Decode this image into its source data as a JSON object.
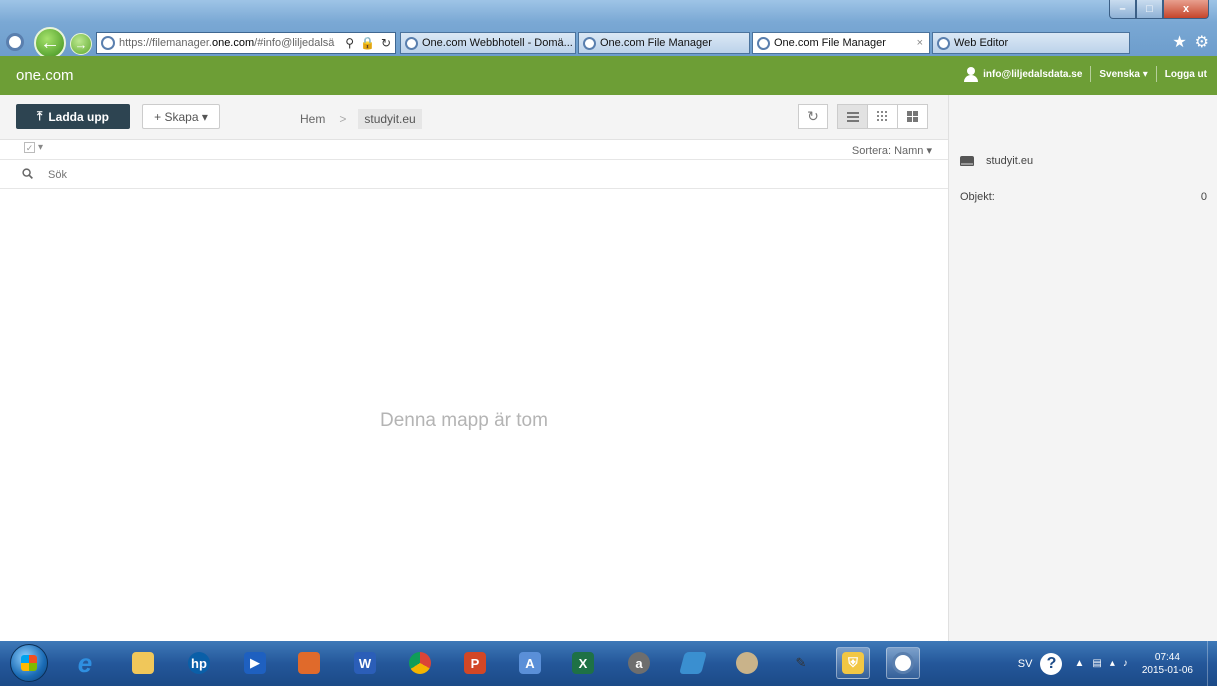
{
  "browser": {
    "address_url_prefix": "https://filemanager.",
    "address_url_domain": "one.com",
    "address_url_suffix": "/#info@liljedalsä",
    "tabs": [
      {
        "label": "One.com Webbhotell - Domä...",
        "active": false
      },
      {
        "label": "One.com File Manager",
        "active": false
      },
      {
        "label": "One.com File Manager",
        "active": true
      },
      {
        "label": "Web Editor",
        "active": false
      }
    ],
    "close_tab_glyph": "×"
  },
  "app": {
    "brand": "one.com",
    "user_email": "info@liljedalsdata.se",
    "language": "Svenska ▾",
    "logout": "Logga ut"
  },
  "toolbar": {
    "upload_label": "Ladda upp",
    "upload_icon": "⤒",
    "create_label": "+ Skapa ▾",
    "breadcrumb_home": "Hem",
    "breadcrumb_separator": ">",
    "breadcrumb_current": "studyit.eu",
    "refresh_icon": "↻"
  },
  "list": {
    "select_glyph": "✓",
    "select_caret": "▾",
    "sort_label": "Sortera: Namn ▾",
    "search_placeholder": "Sök",
    "empty_message": "Denna mapp är tom"
  },
  "panel": {
    "folder_name": "studyit.eu",
    "objects_label": "Objekt:",
    "objects_count": "0"
  },
  "taskbar": {
    "apps": [
      "internet-explorer",
      "file-explorer",
      "hp-app",
      "media-player",
      "paint-app",
      "word",
      "chrome",
      "powerpoint-app",
      "text-editor",
      "excel",
      "adobe-app",
      "pen-app",
      "palette-app",
      "pencil-app",
      "security-shield",
      "browser-app"
    ],
    "language": "SV",
    "help_glyph": "?",
    "time": "07:44",
    "date": "2015-01-06"
  }
}
